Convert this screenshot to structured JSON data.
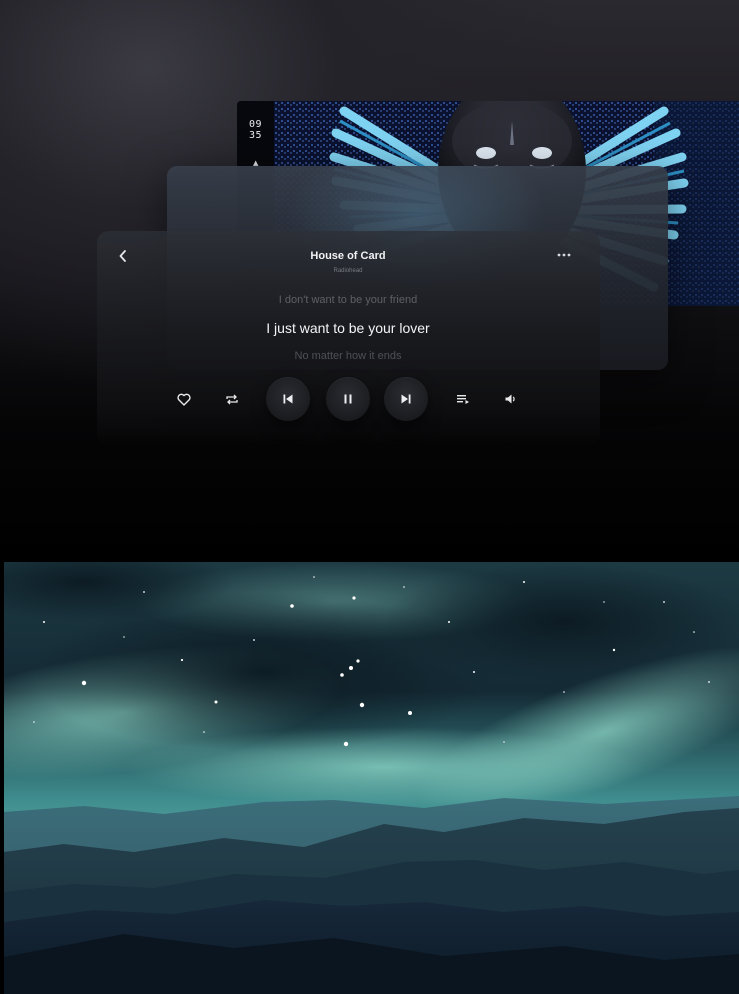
{
  "player": {
    "clock": {
      "hours": "09",
      "minutes": "35"
    },
    "track": {
      "title": "House of Card",
      "artist": "Radiohead"
    },
    "lyrics": {
      "previous": "I don't want to be your friend",
      "current": "I just want to be your lover",
      "next": "No matter how it ends"
    },
    "controls": [
      "heart-icon",
      "repeat-icon",
      "skip-previous-icon",
      "pause-icon",
      "skip-next-icon",
      "queue-icon",
      "volume-icon"
    ],
    "colors": {
      "accent": "#49b8e6",
      "text": "#f4f4f6",
      "muted": "#5d6067"
    }
  }
}
